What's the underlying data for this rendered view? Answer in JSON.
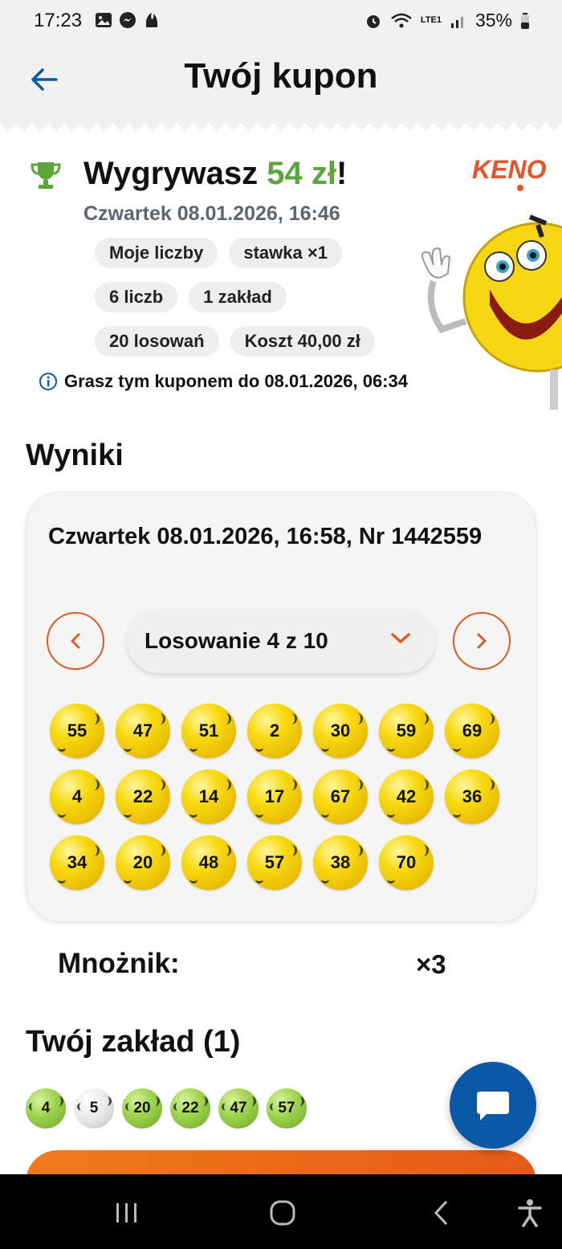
{
  "status": {
    "time": "17:23",
    "battery": "35%",
    "network": "LTE1"
  },
  "header": {
    "title": "Twój kupon",
    "back_icon": "arrow-left-icon"
  },
  "summary": {
    "headline_prefix": "Wygrywasz ",
    "headline_amount": "54 zł",
    "headline_suffix": "!",
    "date": "Czwartek 08.01.2026, 16:46",
    "chips": [
      [
        "Moje liczby",
        "stawka ×1"
      ],
      [
        "6 liczb",
        "1 zakład"
      ],
      [
        "20 losowań",
        "Koszt 40,00 zł"
      ]
    ],
    "info": "Grasz tym kuponem do 08.01.2026, 06:34",
    "logo_text": "KENO"
  },
  "results": {
    "title": "Wyniki",
    "date_line": "Czwartek 08.01.2026, 16:58, Nr 1442559",
    "draw_label": "Losowanie 4 z 10",
    "numbers": [
      "55",
      "47",
      "51",
      "2",
      "30",
      "59",
      "69",
      "4",
      "22",
      "14",
      "17",
      "67",
      "42",
      "36",
      "34",
      "20",
      "48",
      "57",
      "38",
      "70"
    ],
    "multiplier_label": "Mnożnik:",
    "multiplier_value": "×3"
  },
  "bet": {
    "title": "Twój zakład (1)",
    "numbers": [
      {
        "n": "4",
        "hit": true
      },
      {
        "n": "5",
        "hit": false
      },
      {
        "n": "20",
        "hit": true
      },
      {
        "n": "22",
        "hit": true
      },
      {
        "n": "47",
        "hit": true
      },
      {
        "n": "57",
        "hit": true
      }
    ]
  },
  "colors": {
    "accent_orange": "#e05a24",
    "win_green": "#5ba53a",
    "chat_blue": "#0b58a6"
  }
}
